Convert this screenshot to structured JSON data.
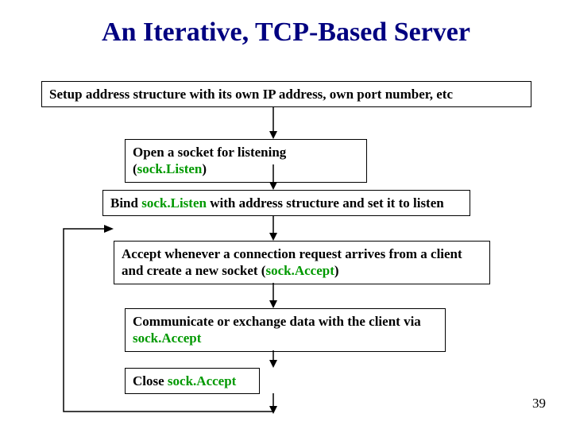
{
  "title": "An Iterative, TCP-Based Server",
  "boxes": {
    "setup": {
      "text": "Setup address structure with its own IP address, own port number, etc"
    },
    "open": {
      "pre": "Open a socket for listening (",
      "kw": "sock.Listen",
      "post": ")"
    },
    "bind": {
      "pre": "Bind ",
      "kw": "sock.Listen",
      "post": " with address structure and set it to listen"
    },
    "accept": {
      "pre": "Accept whenever a connection request arrives from a client and create a new socket (",
      "kw": "sock.Accept",
      "post": ")"
    },
    "comm": {
      "pre": "Communicate or exchange data with the client via  ",
      "kw": "sock.Accept",
      "post": ""
    },
    "close": {
      "pre": "Close ",
      "kw": "sock.Accept",
      "post": ""
    }
  },
  "page_number": "39"
}
